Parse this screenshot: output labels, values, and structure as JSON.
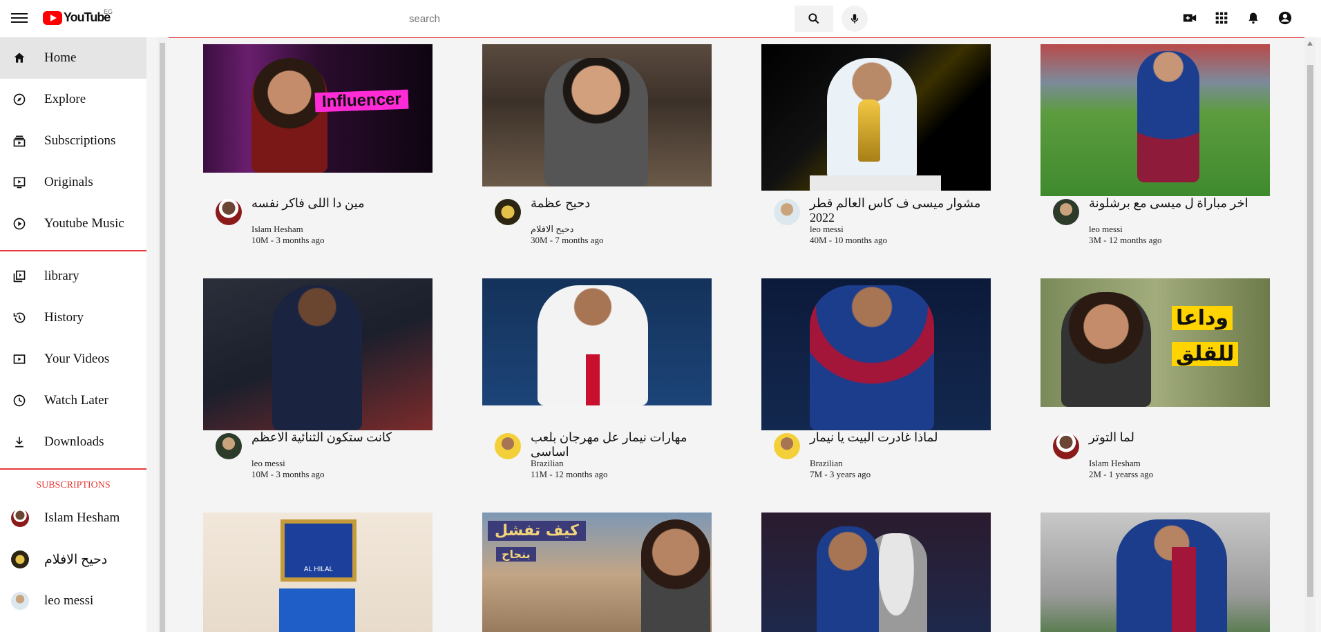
{
  "header": {
    "logo_text": "YouTube",
    "country": "EG",
    "search_placeholder": "search"
  },
  "sidebar": {
    "main": [
      {
        "label": "Home",
        "icon": "home-icon",
        "active": true
      },
      {
        "label": "Explore",
        "icon": "compass-icon"
      },
      {
        "label": "Subscriptions",
        "icon": "subscriptions-icon"
      },
      {
        "label": "Originals",
        "icon": "originals-icon"
      },
      {
        "label": "Youtube Music",
        "icon": "music-icon"
      }
    ],
    "library": [
      {
        "label": "library",
        "icon": "library-icon"
      },
      {
        "label": "History",
        "icon": "history-icon"
      },
      {
        "label": "Your Videos",
        "icon": "your-videos-icon"
      },
      {
        "label": "Watch Later",
        "icon": "clock-icon"
      },
      {
        "label": "Downloads",
        "icon": "download-icon"
      }
    ],
    "subscriptions_title": "SUBSCRIPTIONS",
    "subscriptions": [
      {
        "label": "Islam Hesham"
      },
      {
        "label": "دحيح الافلام"
      },
      {
        "label": "leo messi"
      }
    ]
  },
  "videos": [
    {
      "title": "مين دا اللى فاكر نفسه",
      "channel": "Islam Hesham",
      "stats": "10M - 3 months ago"
    },
    {
      "title": "دحيح عظمة",
      "channel": "دحيح الافلام",
      "stats": "30M - 7 months ago"
    },
    {
      "title": "مشوار ميسى ف كاس العالم قطر 2022",
      "channel": "leo messi",
      "stats": "40M - 10 months ago"
    },
    {
      "title": "اخر مباراة ل ميسى مع برشلونة",
      "channel": "leo messi",
      "stats": "3M - 12 months ago"
    },
    {
      "title": "كانت ستكون الثنائية الاعظم",
      "channel": "leo messi",
      "stats": "10M - 3 months ago"
    },
    {
      "title": "مهارات نيمار عل مهرجان بلعب اساسى",
      "channel": "Brazilian",
      "stats": "11M - 12 months ago"
    },
    {
      "title": "لماذا غادرت البيت يا نيمار",
      "channel": "Brazilian",
      "stats": "7M - 3 years ago"
    },
    {
      "title": "لما التوتر",
      "channel": "Islam Hesham",
      "stats": "2M - 1 yearss ago"
    },
    {
      "title": "",
      "channel": "",
      "stats": ""
    },
    {
      "title": "",
      "channel": "",
      "stats": ""
    },
    {
      "title": "",
      "channel": "",
      "stats": ""
    },
    {
      "title": "",
      "channel": "",
      "stats": ""
    }
  ],
  "thumb_text": {
    "influencer": "Influencer",
    "wadaan": "وداعا",
    "lilqalaq": "للقلق",
    "kayf": "كيف تفشل",
    "binajah": "بنجاح",
    "alhilal": "AL HILAL"
  }
}
